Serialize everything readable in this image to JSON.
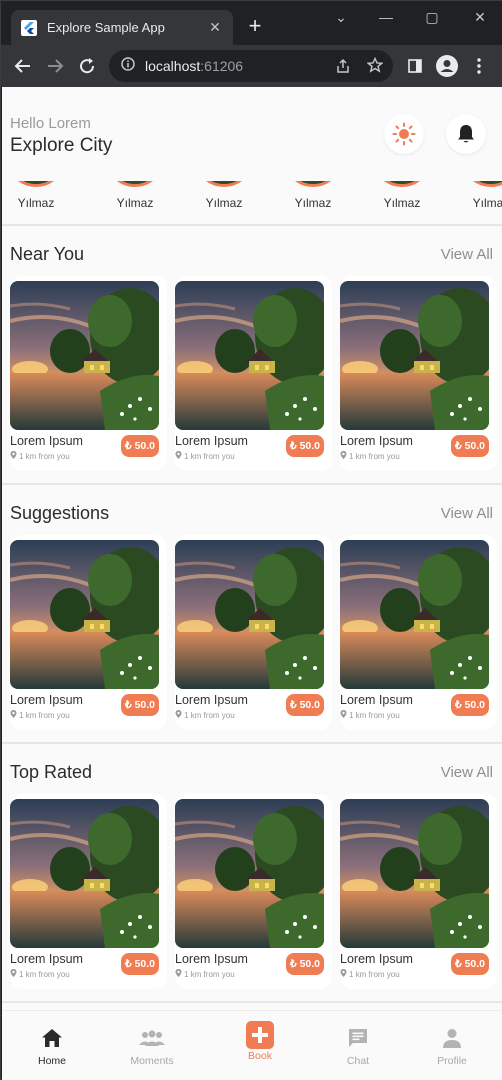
{
  "browser": {
    "tab_title": "Explore Sample App",
    "url_host": "localhost",
    "url_port": ":61206"
  },
  "header": {
    "greeting": "Hello Lorem",
    "city": "Explore City"
  },
  "stories": [
    {
      "name": "Yılmaz"
    },
    {
      "name": "Yılmaz"
    },
    {
      "name": "Yılmaz"
    },
    {
      "name": "Yılmaz"
    },
    {
      "name": "Yılmaz"
    },
    {
      "name": "Yılmaz"
    }
  ],
  "sections": [
    {
      "title": "Near You",
      "view_all": "View All",
      "cards": [
        {
          "title": "Lorem Ipsum",
          "distance": "1 km from you",
          "price": "₺ 50.0"
        },
        {
          "title": "Lorem Ipsum",
          "distance": "1 km from you",
          "price": "₺ 50.0"
        },
        {
          "title": "Lorem Ipsum",
          "distance": "1 km from you",
          "price": "₺ 50.0"
        }
      ]
    },
    {
      "title": "Suggestions",
      "view_all": "View All",
      "cards": [
        {
          "title": "Lorem Ipsum",
          "distance": "1 km from you",
          "price": "₺ 50.0"
        },
        {
          "title": "Lorem Ipsum",
          "distance": "1 km from you",
          "price": "₺ 50.0"
        },
        {
          "title": "Lorem Ipsum",
          "distance": "1 km from you",
          "price": "₺ 50.0"
        }
      ]
    },
    {
      "title": "Top Rated",
      "view_all": "View All",
      "cards": [
        {
          "title": "Lorem Ipsum",
          "distance": "1 km from you",
          "price": "₺ 50.0"
        },
        {
          "title": "Lorem Ipsum",
          "distance": "1 km from you",
          "price": "₺ 50.0"
        },
        {
          "title": "Lorem Ipsum",
          "distance": "1 km from you",
          "price": "₺ 50.0"
        }
      ]
    }
  ],
  "bottom_nav": [
    {
      "label": "Home",
      "icon": "home-icon"
    },
    {
      "label": "Moments",
      "icon": "people-icon"
    },
    {
      "label": "Book",
      "icon": "plus-box-icon"
    },
    {
      "label": "Chat",
      "icon": "chat-icon"
    },
    {
      "label": "Profile",
      "icon": "person-icon"
    }
  ],
  "colors": {
    "accent": "#ef7c52",
    "active": "#2b2b2b",
    "inactive": "#a8a8a8"
  }
}
